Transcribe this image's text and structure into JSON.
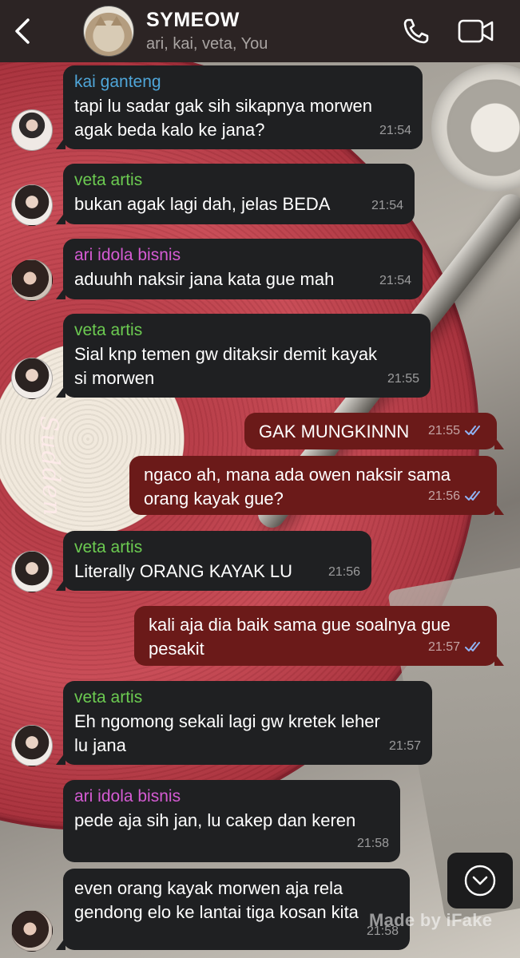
{
  "header": {
    "group_name": "SYMEOW",
    "members": "ari, kai, veta, You",
    "back_icon": "chevron-left-icon",
    "call_icon": "phone-icon",
    "video_icon": "video-camera-icon"
  },
  "colors": {
    "header_bg": "#2c2424",
    "incoming_bubble": "#1f2022",
    "outgoing_bubble": "#6b1a19",
    "sender_kai": "#4fa6d9",
    "sender_veta": "#6ccb51",
    "sender_ari": "#d55bd3",
    "read_ticks": "#8fb2f2"
  },
  "messages": [
    {
      "direction": "in",
      "sender": "kai ganteng",
      "text": "tapi lu sadar gak sih sikapnya morwen\nagak beda kalo ke jana?",
      "time": "21:54"
    },
    {
      "direction": "in",
      "sender": "veta artis",
      "text": "bukan agak lagi dah, jelas BEDA",
      "time": "21:54"
    },
    {
      "direction": "in",
      "sender": "ari idola bisnis",
      "text": "aduuhh naksir jana kata gue mah",
      "time": "21:54"
    },
    {
      "direction": "in",
      "sender": "veta artis",
      "text": "Sial knp temen gw ditaksir demit kayak\nsi morwen",
      "time": "21:55"
    },
    {
      "direction": "out",
      "text": "GAK MUNGKINNN",
      "time": "21:55",
      "status": "read"
    },
    {
      "direction": "out",
      "text": "ngaco ah, mana ada owen naksir sama\norang kayak gue?",
      "time": "21:56",
      "status": "read"
    },
    {
      "direction": "in",
      "sender": "veta artis",
      "text": "Literally ORANG KAYAK LU",
      "time": "21:56"
    },
    {
      "direction": "out",
      "text": "kali aja dia baik sama gue soalnya gue\npesakit",
      "time": "21:57",
      "status": "read"
    },
    {
      "direction": "in",
      "sender": "veta artis",
      "text": "Eh ngomong sekali lagi gw kretek leher\nlu jana",
      "time": "21:57"
    },
    {
      "direction": "in",
      "sender": "ari idola bisnis",
      "text": "pede aja sih jan, lu cakep dan keren",
      "time": "21:58"
    },
    {
      "direction": "in",
      "text": "even orang kayak morwen aja rela\ngendong elo ke lantai tiga kosan kita",
      "time": "21:58"
    }
  ],
  "background_text": "Sudden",
  "scroll_icon": "chevron-down-circle-icon",
  "watermark": "Made by iFake"
}
